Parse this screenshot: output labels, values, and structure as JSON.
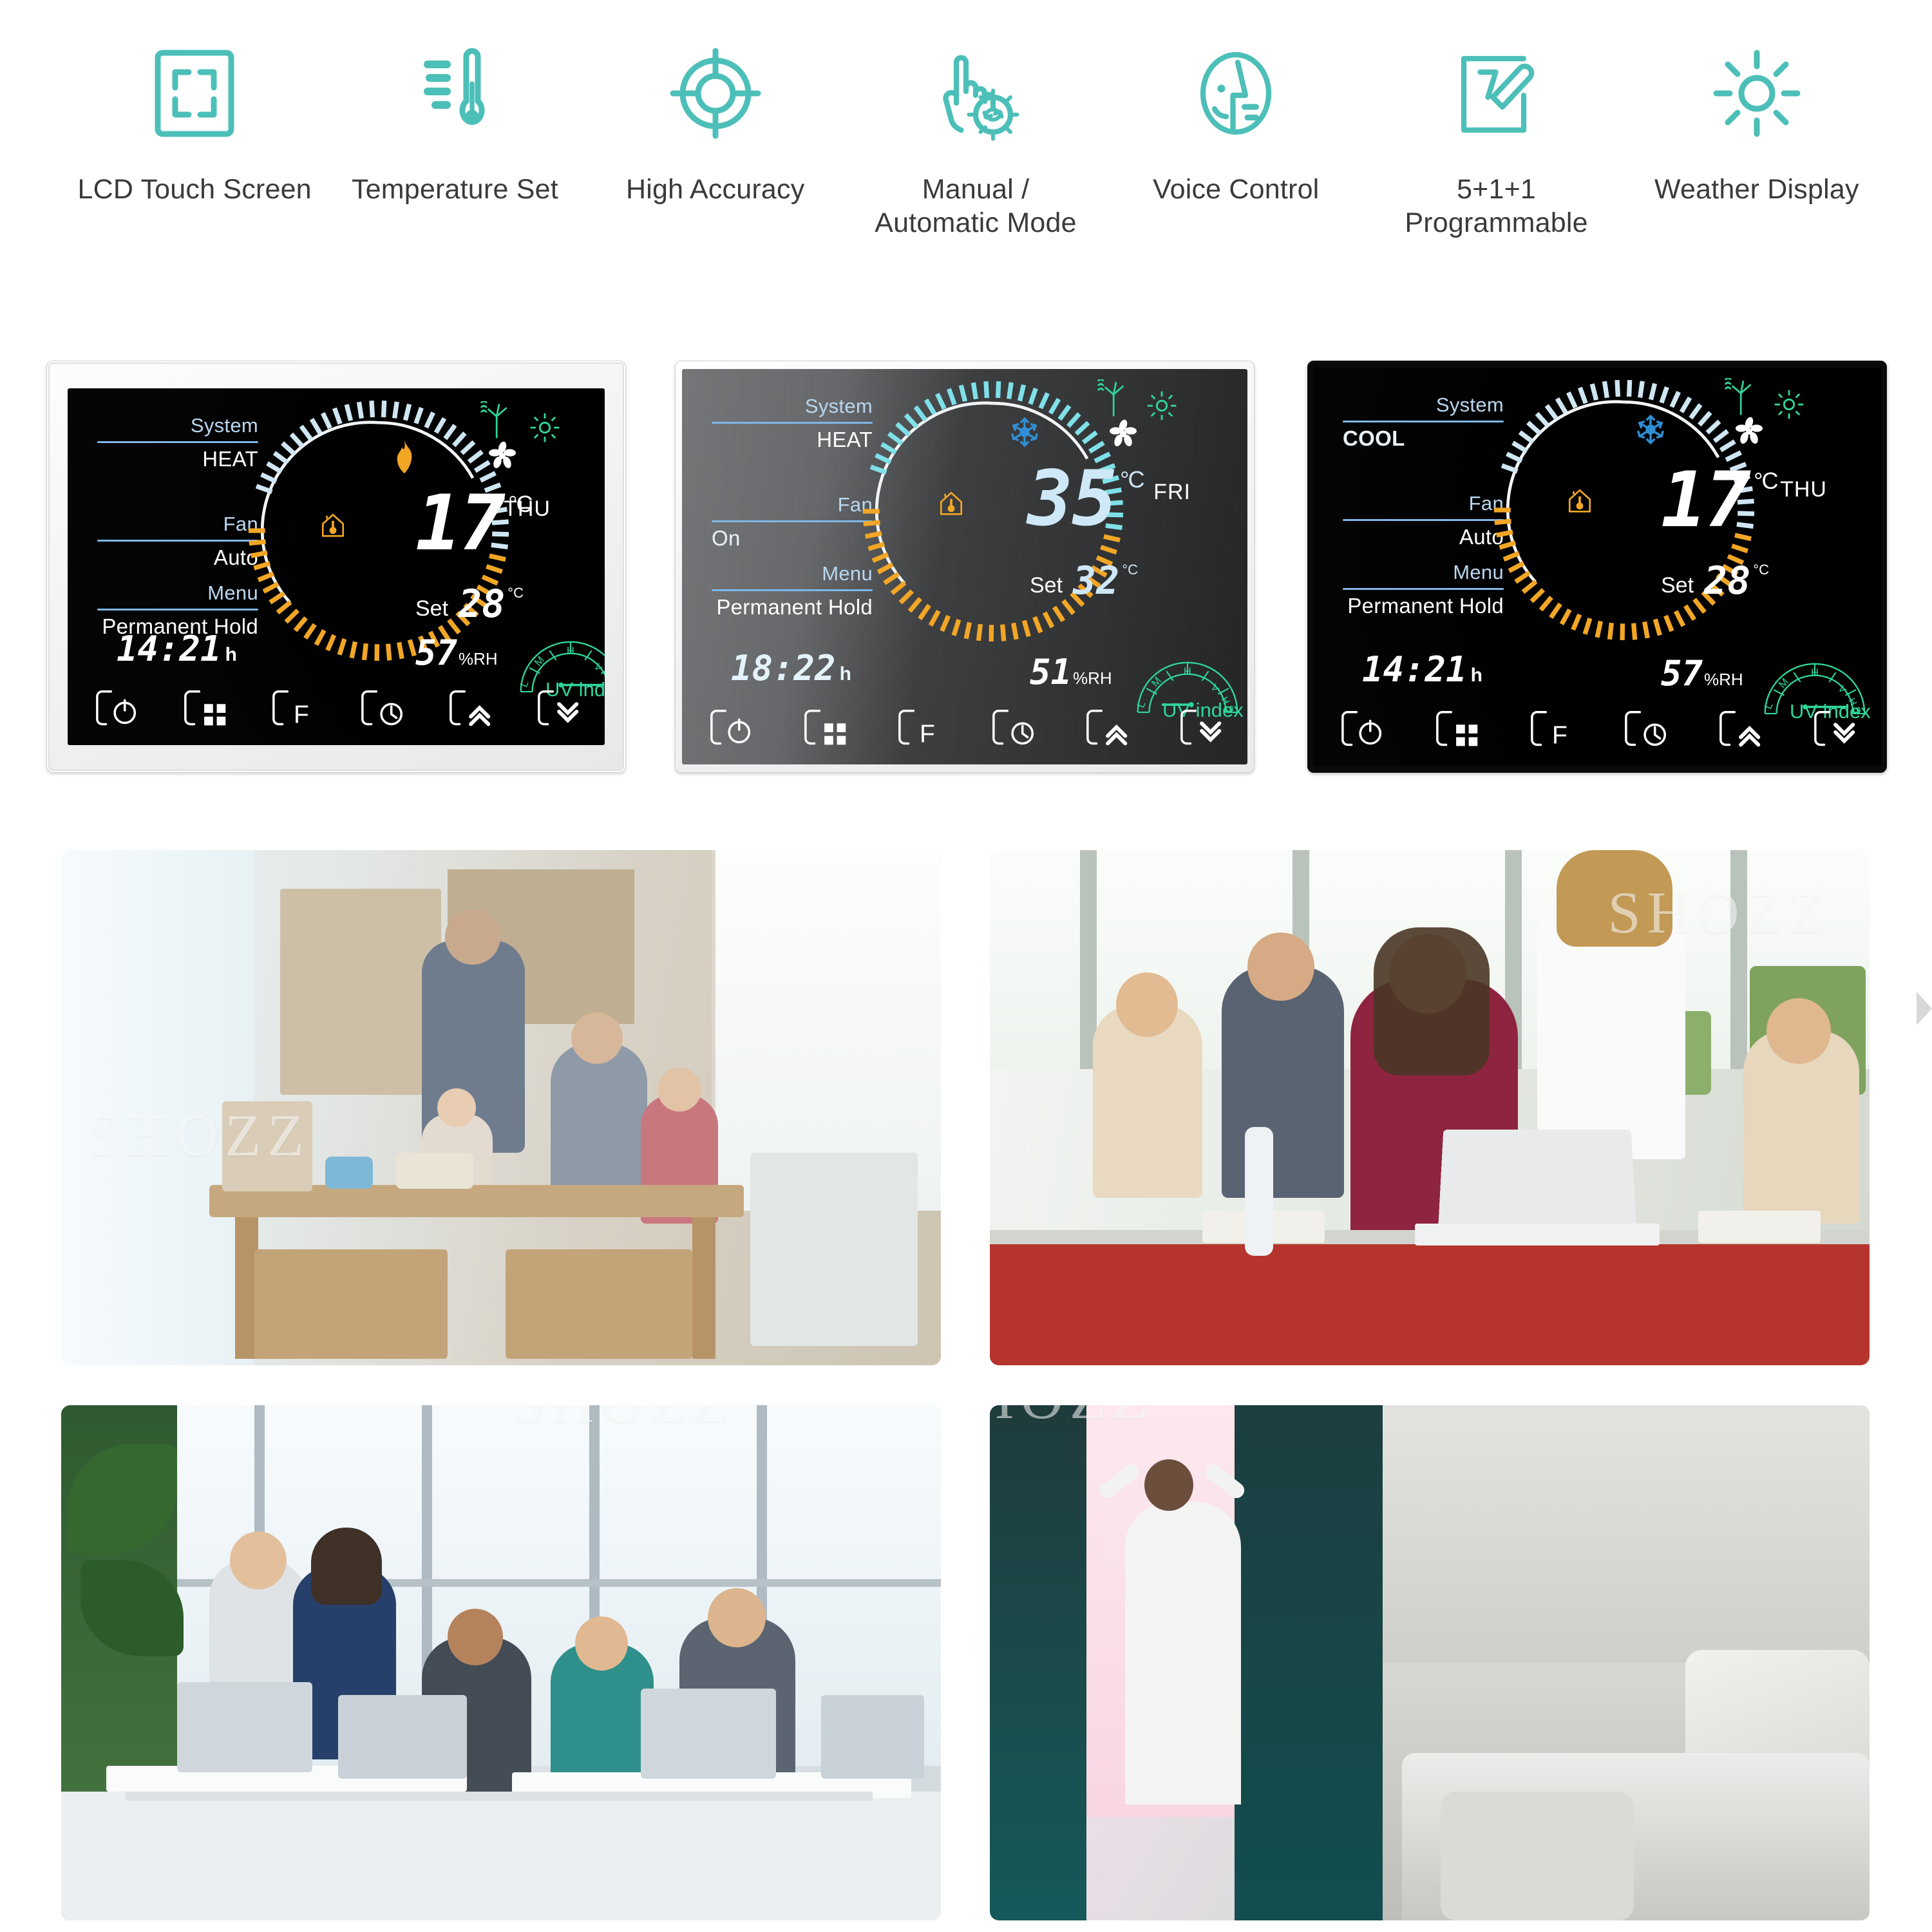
{
  "features": [
    {
      "icon": "lcd-touch-screen-icon",
      "label": "LCD Touch Screen"
    },
    {
      "icon": "thermometer-icon",
      "label": "Temperature Set"
    },
    {
      "icon": "crosshair-target-icon",
      "label": "High Accuracy"
    },
    {
      "icon": "hand-tap-auto-icon",
      "label": "Manual /\nAutomatic Mode"
    },
    {
      "icon": "voice-control-face-icon",
      "label": "Voice Control"
    },
    {
      "icon": "programmable-note-pencil-icon",
      "label": "5+1+1\nProgrammable"
    },
    {
      "icon": "sun-weather-icon",
      "label": "Weather Display"
    }
  ],
  "accent_color": "#4cbfb8",
  "label_color": "#3a3a3a",
  "thermostats": [
    {
      "variant": "white",
      "system_label": "System",
      "system_value": "HEAT",
      "fan_label": "Fan",
      "fan_value": "Auto",
      "menu_label": "Menu",
      "menu_value": "Permanent Hold",
      "temperature": "17",
      "temperature_unit": "°C",
      "set_label": "Set",
      "set_value": "28",
      "set_unit": "°C",
      "clock": "14:21",
      "clock_unit": "h",
      "humidity": "57",
      "humidity_unit": "%RH",
      "weekday": "THU",
      "uv_label": "UV index",
      "uv_scale": [
        "L",
        "M",
        "H",
        "VH",
        "EH"
      ],
      "uv_level": "EH",
      "mode_icon": "flame-icon",
      "secondary_icon": "fan-blades-icon",
      "indoor_icon": "house-thermometer-icon",
      "weather_icons": [
        "wind-turbine-icon",
        "sun-icon"
      ],
      "buttons": [
        "power-icon",
        "grid-menu-icon",
        "fahrenheit-icon",
        "clock-icon",
        "chevron-up-icon",
        "chevron-down-icon"
      ]
    },
    {
      "variant": "silver",
      "system_label": "System",
      "system_value": "HEAT",
      "fan_label": "Fan",
      "fan_value": "On",
      "menu_label": "Menu",
      "menu_value": "Permanent Hold",
      "temperature": "35",
      "temperature_unit": "°C",
      "set_label": "Set",
      "set_value": "32",
      "set_unit": "°C",
      "clock": "18:22",
      "clock_unit": "h",
      "humidity": "51",
      "humidity_unit": "%RH",
      "weekday": "FRI",
      "uv_label": "UV index",
      "uv_scale": [
        "L",
        "M",
        "H",
        "VH",
        "EH"
      ],
      "uv_level": "M",
      "mode_icon": "snowflake-icon",
      "secondary_icon": "fan-blades-icon",
      "indoor_icon": "house-thermometer-icon",
      "weather_icons": [
        "wind-turbine-icon",
        "sun-icon"
      ],
      "buttons": [
        "power-icon",
        "grid-menu-icon",
        "fahrenheit-icon",
        "clock-icon",
        "chevron-up-icon",
        "chevron-down-icon"
      ]
    },
    {
      "variant": "black",
      "system_label": "System",
      "system_value": "COOL",
      "fan_label": "Fan",
      "fan_value": "Auto",
      "menu_label": "Menu",
      "menu_value": "Permanent Hold",
      "temperature": "17",
      "temperature_unit": "°C",
      "set_label": "Set",
      "set_value": "28",
      "set_unit": "°C",
      "clock": "14:21",
      "clock_unit": "h",
      "humidity": "57",
      "humidity_unit": "%RH",
      "weekday": "THU",
      "uv_label": "UV index",
      "uv_scale": [
        "L",
        "M",
        "H",
        "VH",
        "EH"
      ],
      "uv_level": "EH",
      "mode_icon": "snowflake-icon",
      "secondary_icon": "fan-blades-icon",
      "indoor_icon": "house-thermometer-icon",
      "weather_icons": [
        "wind-turbine-icon",
        "sun-icon"
      ],
      "buttons": [
        "power-icon",
        "grid-menu-icon",
        "fahrenheit-icon",
        "clock-icon",
        "chevron-up-icon",
        "chevron-down-icon"
      ]
    }
  ],
  "photos": [
    {
      "name": "family-kitchen-photo",
      "watermark": "SHOZZ"
    },
    {
      "name": "classroom-students-photo",
      "watermark": "SHOZZ"
    },
    {
      "name": "open-plan-office-photo",
      "watermark": "SHOZZ"
    },
    {
      "name": "bedroom-morning-window-photo",
      "watermark": "SHOZZ"
    }
  ]
}
